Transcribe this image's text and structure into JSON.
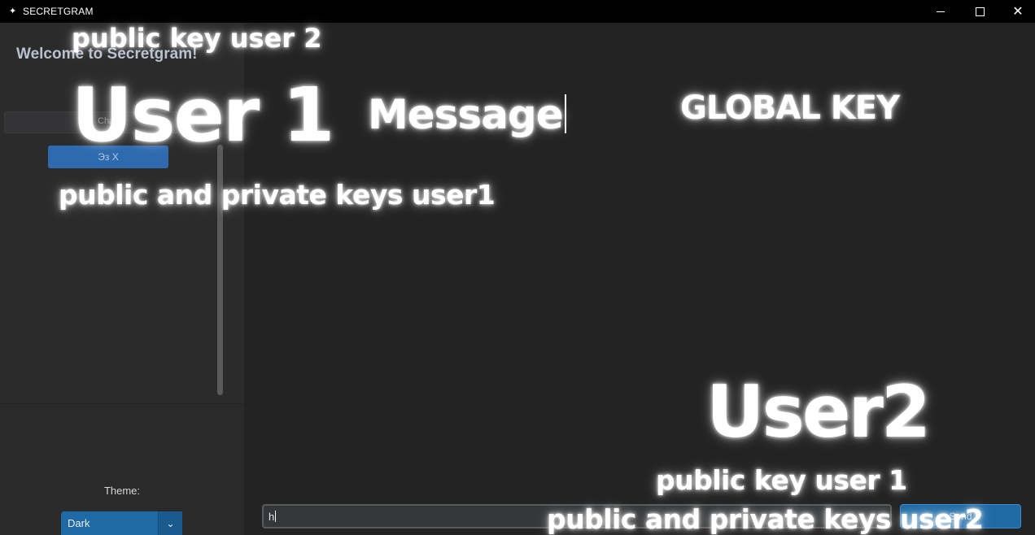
{
  "window": {
    "title": "SECRETGRAM",
    "app_icon": "✦",
    "minimize_icon": "minimize-icon",
    "maximize_icon": "maximize-icon",
    "close_icon": "close-icon",
    "close_glyph": "✕"
  },
  "sidebar": {
    "welcome": "Welcome to Secretgram!",
    "chat_button_label": "Cha",
    "list_item_label": "Эз X",
    "theme_label": "Theme:",
    "theme_value": "Dark",
    "theme_dropdown_icon": "chevron-down-icon",
    "theme_dropdown_glyph": "⌄"
  },
  "composer": {
    "input_value": "h",
    "send_label": "Send"
  },
  "overlays": {
    "public_key_user_2": "public key user 2",
    "user_1": "User 1",
    "message": "Message",
    "global_key": "GLOBAL KEY",
    "public_private_keys_user1": "public and private keys user1",
    "user_2": "User2",
    "public_key_user_1": "public key user 1",
    "public_private_keys_user2": "public and private keys user2"
  },
  "colors": {
    "titlebar": "#000000",
    "sidebar": "#2b2b2c",
    "main": "#232324",
    "accent": "#1f6aa5",
    "welcome_text": "#b9c1cf"
  }
}
